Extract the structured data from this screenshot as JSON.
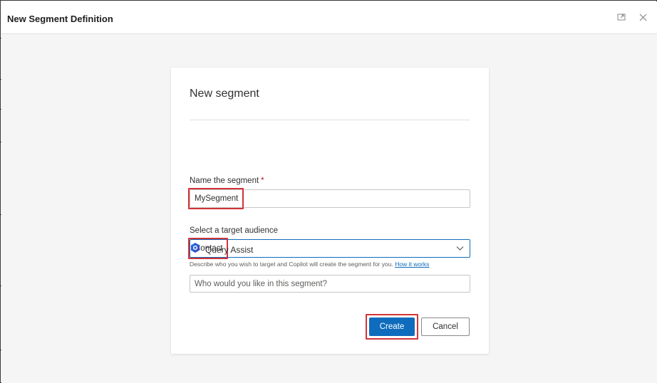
{
  "window": {
    "title": "New Segment Definition",
    "icons": {
      "expand": "expand-icon",
      "close": "close-icon"
    }
  },
  "card": {
    "title": "New segment",
    "name_field": {
      "label": "Name the segment",
      "required_mark": "*",
      "value": "MySegment"
    },
    "audience_field": {
      "label": "Select a target audience",
      "value": "Contact",
      "icon": "chevron-down-icon"
    },
    "query_assist": {
      "label": "Query Assist",
      "icon": "copilot-icon",
      "description": "Describe who you wish to target and Copilot will create the segment for you.",
      "link": "How it works",
      "placeholder": "Who would you like in this segment?"
    },
    "buttons": {
      "create": "Create",
      "cancel": "Cancel"
    }
  },
  "colors": {
    "accent": "#0f6cbd",
    "highlight": "#d13438",
    "required": "#c50f1f"
  }
}
